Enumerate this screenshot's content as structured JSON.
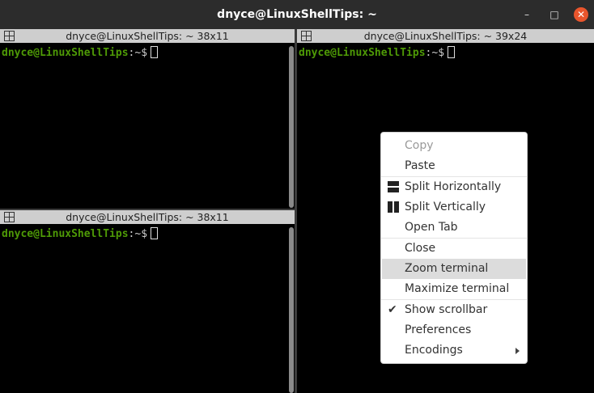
{
  "window": {
    "title": "dnyce@LinuxShellTips: ~",
    "minimize_glyph": "–",
    "maximize_glyph": "□",
    "close_glyph": "✕"
  },
  "panes": [
    {
      "title": "dnyce@LinuxShellTips: ~ 38x11",
      "user_host": "dnyce@LinuxShellTips",
      "path_prompt": ":~$"
    },
    {
      "title": "dnyce@LinuxShellTips: ~ 38x11",
      "user_host": "dnyce@LinuxShellTips",
      "path_prompt": ":~$"
    },
    {
      "title": "dnyce@LinuxShellTips: ~ 39x24",
      "user_host": "dnyce@LinuxShellTips",
      "path_prompt": ":~$"
    }
  ],
  "context_menu": {
    "items": [
      {
        "label": "Copy",
        "enabled": false
      },
      {
        "label": "Paste",
        "enabled": true
      },
      {
        "label": "Split Horizontally",
        "icon": "split-horizontal-icon"
      },
      {
        "label": "Split Vertically",
        "icon": "split-vertical-icon"
      },
      {
        "label": "Open Tab"
      },
      {
        "label": "Close"
      },
      {
        "label": "Zoom terminal",
        "highlighted": true
      },
      {
        "label": "Maximize terminal"
      },
      {
        "label": "Show scrollbar",
        "checked": true
      },
      {
        "label": "Preferences"
      },
      {
        "label": "Encodings",
        "submenu": true
      }
    ]
  },
  "colors": {
    "prompt_user": "#4e9a06",
    "terminal_bg": "#000000",
    "titlebar_bg": "#2c2c2c",
    "close_button": "#e9552c",
    "pane_title_bg": "#cecece"
  }
}
